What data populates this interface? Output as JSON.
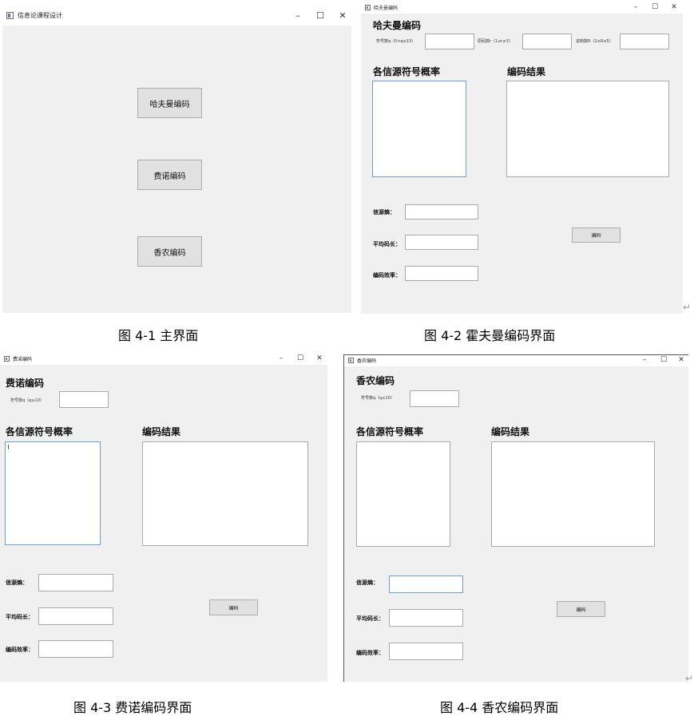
{
  "win1": {
    "title": "信息论课程设计",
    "min": "–",
    "max": "☐",
    "close": "✕",
    "buttons": {
      "huffman": "哈夫曼编码",
      "fano": "费诺编码",
      "shannon": "香农编码"
    }
  },
  "win2": {
    "title": "哈夫曼编码",
    "min": "–",
    "max": "☐",
    "close": "✕",
    "heading": "哈夫曼编码",
    "param1": "符号数q（0<q≤15）",
    "param2": "原码数r（1≤r≤3）",
    "param3": "进制数R（2≤R≤5）",
    "prob_label": "各信源符号概率",
    "result_label": "编码结果",
    "entropy_label": "信源熵：",
    "avglen_label": "平均码长：",
    "eff_label": "编码效率：",
    "encode_btn": "编码"
  },
  "win3": {
    "title": "费诺编码",
    "min": "–",
    "max": "☐",
    "close": "✕",
    "heading": "费诺编码",
    "param1": "符号数q（q≥10）",
    "prob_label": "各信源符号概率",
    "result_label": "编码结果",
    "entropy_label": "信源熵：",
    "avglen_label": "平均码长：",
    "eff_label": "编码效率：",
    "encode_btn": "编码"
  },
  "win4": {
    "title": "香农编码",
    "min": "–",
    "max": "☐",
    "close": "✕",
    "heading": "香农编码",
    "param1": "符号数q（q≥10）",
    "prob_label": "各信源符号概率",
    "result_label": "编码结果",
    "entropy_label": "信源熵：",
    "avglen_label": "平均码长：",
    "eff_label": "编码效率：",
    "encode_btn": "编码"
  },
  "captions": {
    "fig1": "图 4-1  主界面",
    "fig2": "图 4-2  霍夫曼编码界面",
    "fig3": "图 4-3  费诺编码界面",
    "fig4": "图 4-4  香农编码界面",
    "return_mark": "↵"
  },
  "colors": {
    "window_bg": "#f0f0f0",
    "titlebar_bg": "#ffffff",
    "focus_border": "#6aa0d8"
  }
}
